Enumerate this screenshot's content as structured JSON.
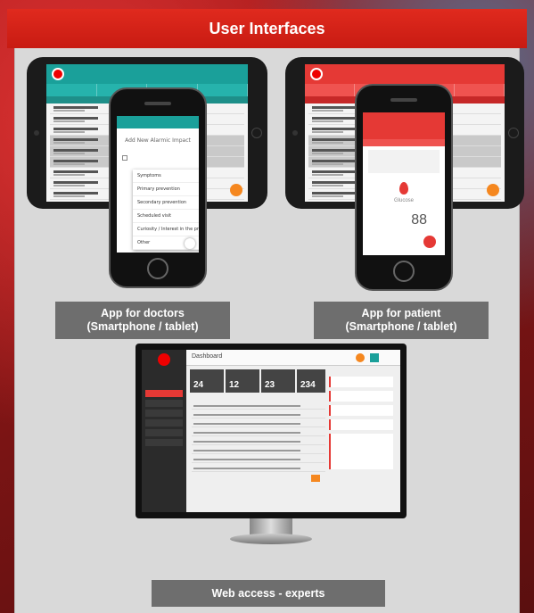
{
  "header": {
    "title": "User Interfaces"
  },
  "captions": {
    "doctors": [
      "App for doctors",
      "(Smartphone / tablet)"
    ],
    "patient": [
      "App for patient",
      "(Smartphone / tablet)"
    ],
    "web": "Web access - experts"
  },
  "doctor_phone": {
    "title": "Add New Alarmic Impact",
    "menu_items": [
      "Symptoms",
      "Primary prevention",
      "Secondary prevention",
      "Scheduled visit",
      "Curiosity / Interest in the program",
      "Other"
    ]
  },
  "patient_phone": {
    "label1": "Glucose",
    "value": "88"
  },
  "dashboard": {
    "title": "Dashboard",
    "kpis": [
      "24",
      "12",
      "23",
      "234"
    ]
  },
  "colors": {
    "header_red": "#d8231a",
    "panel_grey": "#d9d9d9",
    "caption_grey": "#6e6e6e",
    "teal": "#1aa09a",
    "accent_orange": "#f5871f"
  }
}
